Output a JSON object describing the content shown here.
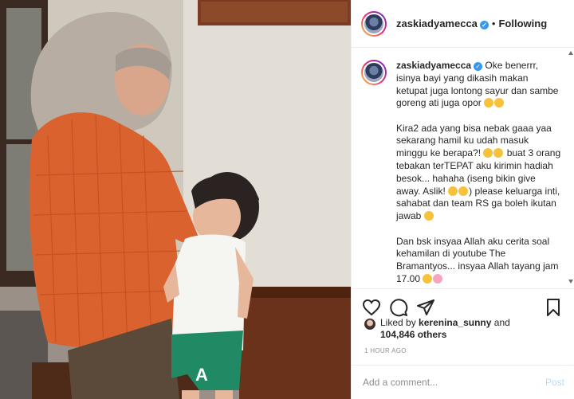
{
  "post": {
    "photo_alt": "",
    "author": {
      "username": "zaskiadyamecca",
      "verified": true,
      "follow_status": "Following"
    },
    "caption": {
      "username": "zaskiadyamecca",
      "paragraphs": [
        "Oke benerrr, isinya bayi yang dikasih makan ketupat juga lontong sayur dan sambe goreng ati juga opor",
        "Kira2 ada yang bisa nebak gaaa yaa sekarang hamil ku udah masuk minggu ke berapa?!",
        "buat 3 orang tebakan terTEPAT aku kirimin hadiah besok... hahaha (iseng bikin give away. Aslik!",
        ") please keluarga inti, sahabat dan team RS ga boleh ikutan jawab",
        "Dan bsk insyaa Allah aku cerita soal kehamilan di youtube The Bramantyos... insyaa Allah tayang jam 17.00"
      ]
    },
    "likes": {
      "prefix": "Liked by",
      "first_liker": "kerenina_sunny",
      "conjunction": "and",
      "others": "104,846 others"
    },
    "timestamp": "1 HOUR AGO",
    "comment_box": {
      "placeholder": "Add a comment...",
      "post_label": "Post"
    }
  },
  "colors": {
    "verified": "#3897f0",
    "post_button": "#b2dffc",
    "muted_text": "#8e8e8e",
    "orange_blouse": "#d9622f"
  },
  "icons": [
    "heart-icon",
    "comment-icon",
    "share-icon",
    "bookmark-icon",
    "verified-badge-icon"
  ]
}
